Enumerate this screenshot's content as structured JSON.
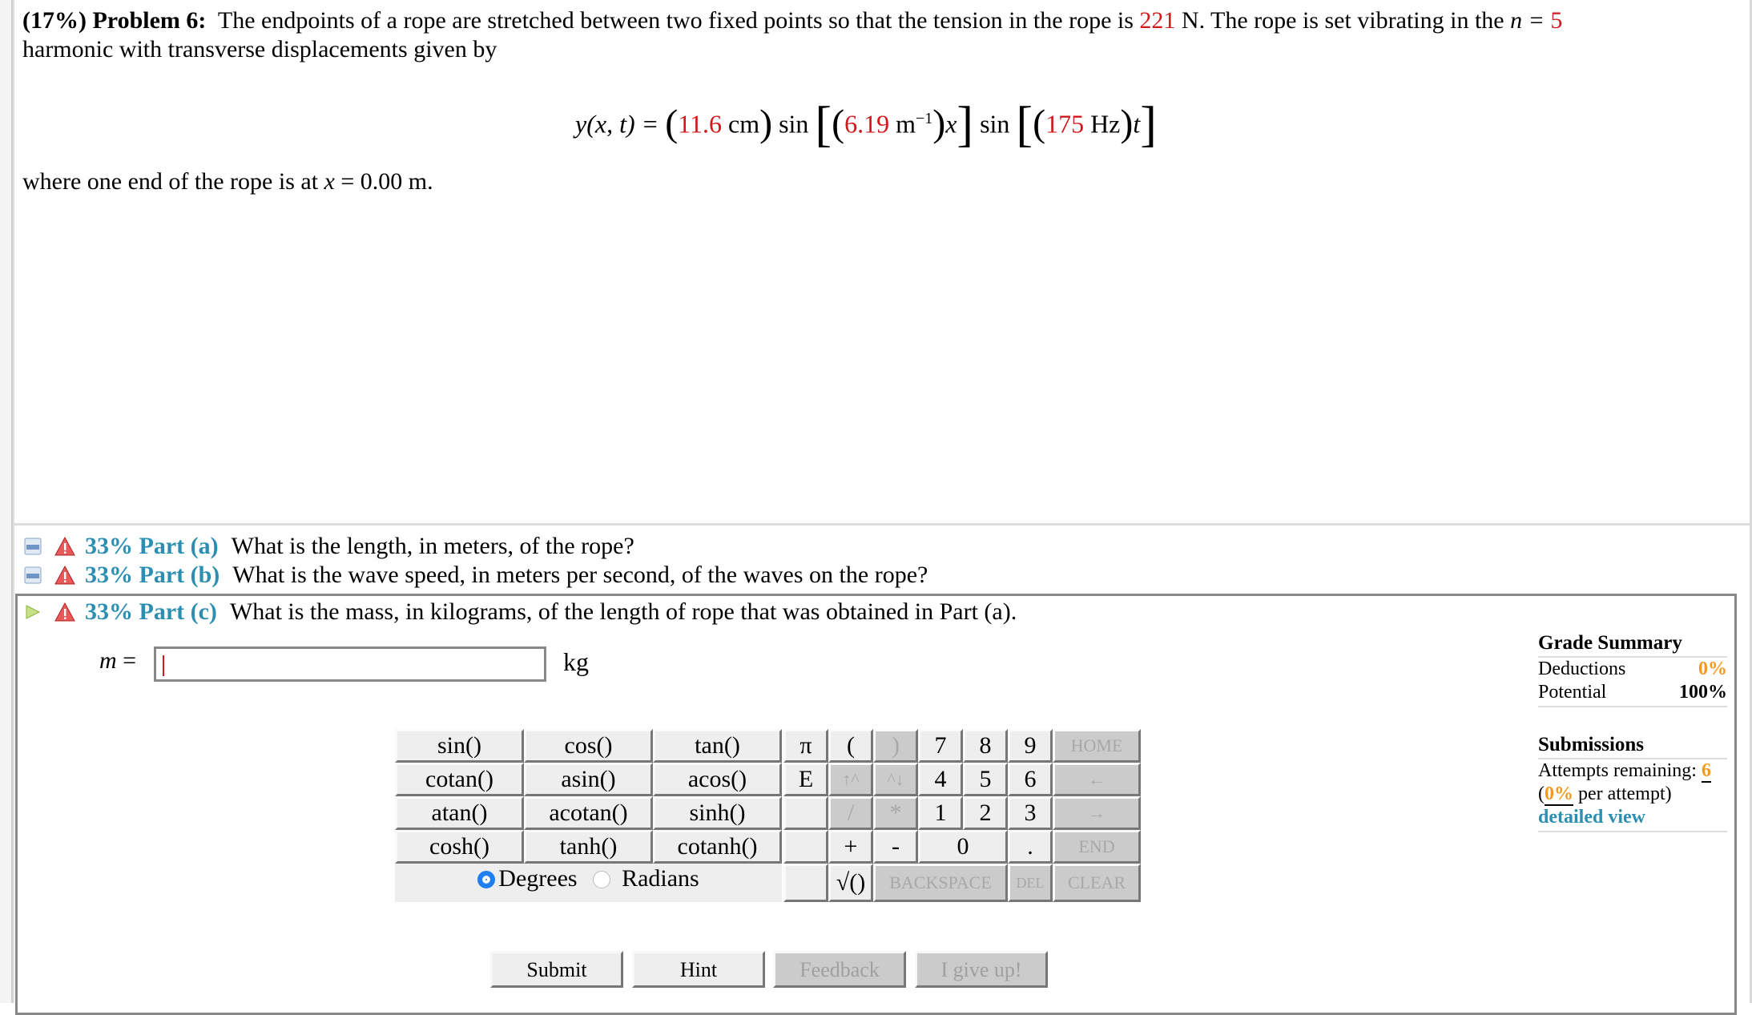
{
  "problem": {
    "weight": "(17%)",
    "title": "Problem 6:",
    "text_1": "The endpoints of a rope are stretched between two fixed points so that the tension in the rope is",
    "tension_value": "221",
    "text_2": "N. The rope is set vibrating in the",
    "n_label": "n =",
    "n_value": "5",
    "text_3": "harmonic with transverse displacements given by",
    "equation": {
      "lhs": "y(x, t) =",
      "amplitude": "11.6",
      "amplitude_unit": "cm",
      "sin_1": "sin",
      "wavenumber": "6.19",
      "wavenumber_unit": "m",
      "wavenumber_exp": "−1",
      "var_x": "x",
      "sin_2": "sin",
      "frequency": "175",
      "frequency_unit": "Hz",
      "var_t": "t"
    },
    "where_text": "where one end of the rope is at",
    "where_var": "x",
    "where_eq": "= 0.00 m."
  },
  "parts": [
    {
      "percent": "33% Part (a)",
      "question": "What is the length, in meters, of the rope?",
      "state": "collapsed"
    },
    {
      "percent": "33% Part (b)",
      "question": "What is the wave speed, in meters per second, of the waves on the rope?",
      "state": "collapsed"
    },
    {
      "percent": "33% Part (c)",
      "question": "What is the mass, in kilograms, of the length of rope that was obtained in Part (a).",
      "state": "active"
    }
  ],
  "answer": {
    "variable": "m",
    "equals": "=",
    "value": "",
    "unit": "kg"
  },
  "keypad": {
    "functions": [
      [
        "sin()",
        "cos()",
        "tan()"
      ],
      [
        "cotan()",
        "asin()",
        "acos()"
      ],
      [
        "atan()",
        "acotan()",
        "sinh()"
      ],
      [
        "cosh()",
        "tanh()",
        "cotanh()"
      ]
    ],
    "angle_mode": {
      "degrees": "Degrees",
      "radians": "Radians",
      "selected": "Degrees"
    },
    "keys": {
      "pi": "π",
      "lparen": "(",
      "rparen": ")",
      "k7": "7",
      "k8": "8",
      "k9": "9",
      "home": "HOME",
      "e": "E",
      "up": "↑^",
      "down": "^↓",
      "k4": "4",
      "k5": "5",
      "k6": "6",
      "left": "←",
      "div": "/",
      "mul": "*",
      "k1": "1",
      "k2": "2",
      "k3": "3",
      "right": "→",
      "plus": "+",
      "minus": "-",
      "k0": "0",
      "dot": ".",
      "end": "END",
      "sqrt": "√()",
      "backspace": "BACKSPACE",
      "del": "DEL",
      "clear": "CLEAR"
    }
  },
  "buttons": {
    "submit": "Submit",
    "hint": "Hint",
    "feedback": "Feedback",
    "give_up": "I give up!"
  },
  "grade_summary": {
    "title": "Grade Summary",
    "deductions_label": "Deductions",
    "deductions_value": "0%",
    "potential_label": "Potential",
    "potential_value": "100%"
  },
  "submissions": {
    "title": "Submissions",
    "attempts_label": "Attempts remaining:",
    "attempts_value": "6",
    "per_attempt_open": "(",
    "per_attempt_value": "0%",
    "per_attempt_text": "per attempt)",
    "detailed_view": "detailed view"
  },
  "colors": {
    "given_value": "#d0191d",
    "part_label": "#2c8fb2",
    "grade_highlight": "#f39a1d",
    "radio_selected": "#1f7ef0"
  }
}
